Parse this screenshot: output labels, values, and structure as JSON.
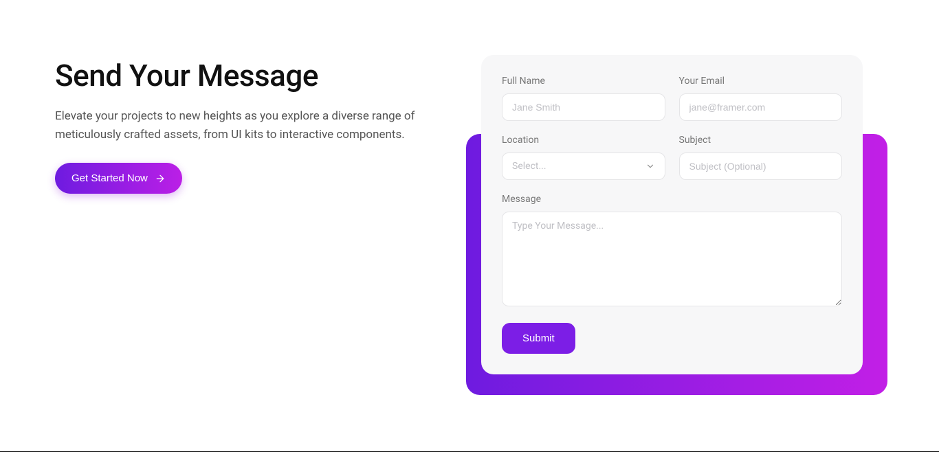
{
  "hero": {
    "heading": "Send Your Message",
    "description": "Elevate your projects to new heights as you explore a diverse range of meticulously crafted assets, from UI kits to interactive components.",
    "cta_label": "Get Started Now"
  },
  "form": {
    "full_name": {
      "label": "Full Name",
      "placeholder": "Jane Smith"
    },
    "email": {
      "label": "Your Email",
      "placeholder": "jane@framer.com"
    },
    "location": {
      "label": "Location",
      "placeholder": "Select..."
    },
    "subject": {
      "label": "Subject",
      "placeholder": "Subject (Optional)"
    },
    "message": {
      "label": "Message",
      "placeholder": "Type Your Message..."
    },
    "submit_label": "Submit"
  }
}
